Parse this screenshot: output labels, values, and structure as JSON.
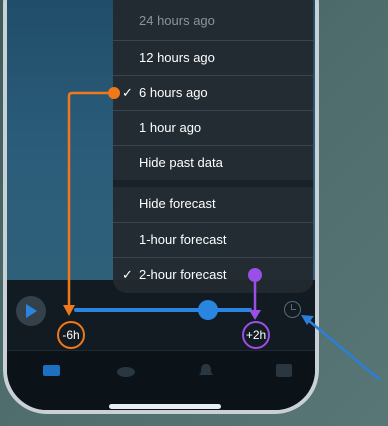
{
  "menu": {
    "items": [
      {
        "label": "24 hours ago",
        "checked": false,
        "dimmed": true
      },
      {
        "label": "12 hours ago",
        "checked": false
      },
      {
        "label": "6 hours ago",
        "checked": true
      },
      {
        "label": "1 hour ago",
        "checked": false
      },
      {
        "label": "Hide past data",
        "checked": false
      },
      {
        "label": "Hide forecast",
        "checked": false
      },
      {
        "label": "1-hour forecast",
        "checked": false
      },
      {
        "label": "2-hour forecast",
        "checked": true
      }
    ],
    "check_glyph": "✓"
  },
  "timeline": {
    "start_label": "-6h",
    "end_label": "+2h",
    "progress": 0.75
  },
  "tabs": [
    "map-icon",
    "cloud-icon",
    "bell-icon",
    "grid-icon"
  ],
  "colors": {
    "accent": "#2a85e0",
    "annotation_orange": "#f07818",
    "annotation_purple": "#9a4fe6",
    "annotation_blue": "#2a7fd8"
  }
}
